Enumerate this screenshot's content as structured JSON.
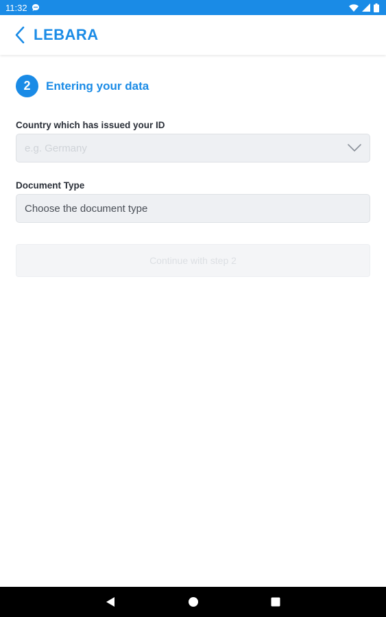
{
  "status_bar": {
    "time": "11:32",
    "background_color": "#1a8be6",
    "icons": [
      "chat-notification-icon",
      "wifi-icon",
      "cell-signal-icon",
      "battery-icon"
    ]
  },
  "app_bar": {
    "title": "LEBARA",
    "back_icon": "chevron-left-icon",
    "accent_color": "#1a8be6"
  },
  "step": {
    "number": "2",
    "title": "Entering your data"
  },
  "country_field": {
    "label": "Country which has issued your ID",
    "placeholder": "e.g. Germany",
    "icon": "chevron-down-icon"
  },
  "document_field": {
    "label": "Document Type",
    "value": "Choose the document type"
  },
  "continue_button": {
    "label": "Continue with step 2",
    "state": "disabled"
  },
  "nav_bar": {
    "icons": [
      "back-triangle-icon",
      "home-circle-icon",
      "recents-square-icon"
    ]
  }
}
